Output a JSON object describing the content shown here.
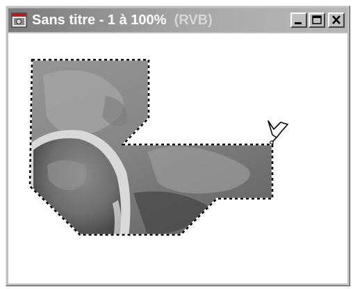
{
  "window": {
    "title_main": "Sans titre - 1 à 100%",
    "title_mode": "(RVB)",
    "icons": {
      "app": "photoshop-document-icon",
      "minimize": "minimize-icon",
      "maximize": "maximize-icon",
      "close": "close-icon"
    }
  },
  "document": {
    "selection": "marching-ants-selection",
    "cursor": "polygonal-lasso-cursor-icon"
  },
  "colors": {
    "titlebar_start": "#7a7a7a",
    "titlebar_end": "#b7b7b7",
    "face": "#c0c0c0",
    "canvas": "#ffffff"
  }
}
